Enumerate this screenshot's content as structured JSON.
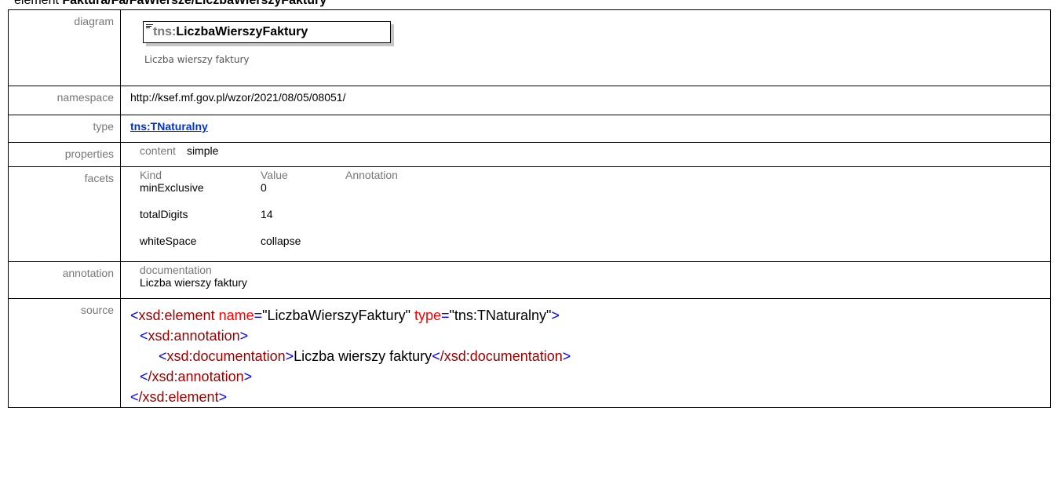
{
  "heading": {
    "prefix": "element ",
    "path": "Faktura/Fa/FaWiersze/LiczbaWierszyFaktury"
  },
  "labels": {
    "diagram": "diagram",
    "namespace": "namespace",
    "type": "type",
    "properties": "properties",
    "facets": "facets",
    "annotation": "annotation",
    "source": "source"
  },
  "diagram": {
    "prefix": "tns:",
    "name": "LiczbaWierszyFaktury",
    "documentation": "Liczba wierszy faktury"
  },
  "namespace": "http://ksef.mf.gov.pl/wzor/2021/08/05/08051/",
  "type": "tns:TNaturalny",
  "properties": {
    "key": "content",
    "value": "simple"
  },
  "facets": {
    "headers": [
      "Kind",
      "Value",
      "Annotation"
    ],
    "rows": [
      {
        "kind": "minExclusive",
        "value": "0"
      },
      {
        "kind": "totalDigits",
        "value": "14"
      },
      {
        "kind": "whiteSpace",
        "value": "collapse"
      }
    ]
  },
  "annotation": {
    "key": "documentation",
    "text": "Liczba wierszy faktury"
  },
  "source": {
    "open_tag": "xsd:element",
    "attr_name": "name",
    "name_value": "\"LiczbaWierszyFaktury\"",
    "attr_type": "type",
    "type_value": "\"tns:TNaturalny\"",
    "annotation_tag": "xsd:annotation",
    "documentation_tag": "xsd:documentation",
    "documentation_text": "Liczba wierszy faktury",
    "close_documentation_tag": "/xsd:documentation",
    "close_annotation_tag": "/xsd:annotation",
    "close_element_tag": "/xsd:element",
    "lt": "<",
    "gt": ">",
    "eq": "=",
    "space": " "
  },
  "colors": {
    "tag": "#990000",
    "bracket": "#0000ff",
    "attribute": "#ff0000",
    "link": "#0033cc",
    "label": "#777777"
  }
}
